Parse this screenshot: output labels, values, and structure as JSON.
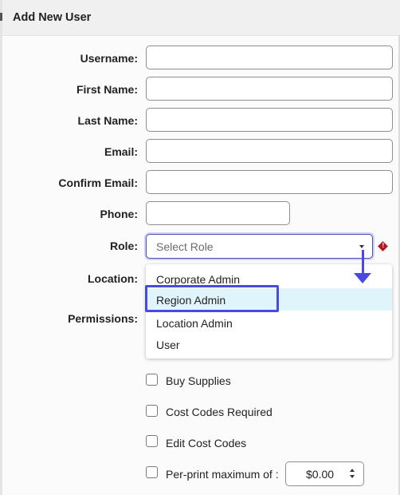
{
  "header": {
    "title": "Add New User"
  },
  "form": {
    "username_label": "Username:",
    "first_name_label": "First Name:",
    "last_name_label": "Last Name:",
    "email_label": "Email:",
    "confirm_email_label": "Confirm Email:",
    "phone_label": "Phone:",
    "role_label": "Role:",
    "location_label": "Location:",
    "permissions_label": "Permissions:",
    "username_value": "",
    "first_name_value": "",
    "last_name_value": "",
    "email_value": "",
    "confirm_email_value": "",
    "phone_value": "",
    "role_placeholder": "Select Role"
  },
  "role_dropdown": {
    "options": [
      "Corporate Admin",
      "Region Admin",
      "Location Admin",
      "User"
    ],
    "highlighted": "Region Admin"
  },
  "permissions": [
    {
      "label": "Buy Supplies",
      "checked": false
    },
    {
      "label": "Cost Codes Required",
      "checked": false
    },
    {
      "label": "Edit Cost Codes",
      "checked": false
    },
    {
      "label": "Per-print maximum of :",
      "checked": false
    }
  ],
  "per_print_max": {
    "value": "$0.00"
  },
  "icons": {
    "required": "exclamation-diamond-icon",
    "dropdown": "caret-down-icon",
    "stepper": "up-down-stepper-icon",
    "annotation": "arrow-down-icon"
  },
  "colors": {
    "annotation": "#4b4ae0",
    "required": "#b3161c",
    "option_hover": "#dff4fb",
    "focus_border": "#4a4fb8"
  }
}
